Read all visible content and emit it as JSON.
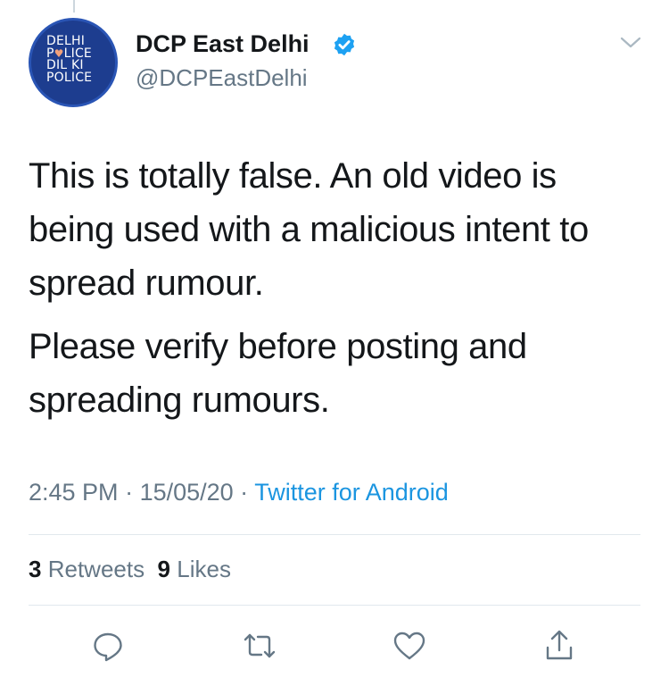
{
  "author": {
    "avatar_lines": [
      "DELHI",
      "P",
      "LICE",
      "DIL KI",
      "POLICE"
    ],
    "display_name": "DCP East Delhi",
    "handle": "@DCPEastDelhi",
    "verified": true
  },
  "tweet": {
    "paragraphs": [
      "This is totally false. An old video is being used with a malicious intent to spread rumour.",
      "Please verify before posting and spreading rumours."
    ]
  },
  "meta": {
    "time": "2:45 PM",
    "separator": " · ",
    "date": "15/05/20",
    "source": "Twitter for Android"
  },
  "stats": {
    "retweets_count": "3",
    "retweets_label": "Retweets",
    "likes_count": "9",
    "likes_label": "Likes"
  },
  "actions": {
    "icons": [
      "reply-icon",
      "retweet-icon",
      "like-icon",
      "share-icon"
    ]
  },
  "colors": {
    "verified": "#1da1f2",
    "link": "#1b95e0",
    "secondary_text": "#657786",
    "avatar_bg": "#1d3d8f"
  }
}
